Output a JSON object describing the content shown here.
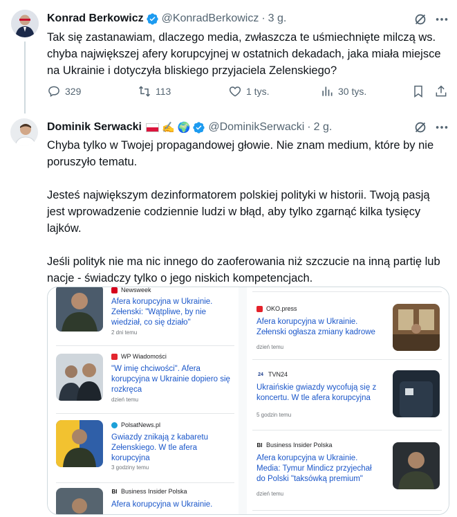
{
  "tweet1": {
    "name": "Konrad Berkowicz",
    "handle": "@KonradBerkowicz",
    "dot": "·",
    "time": "3 g.",
    "text": "Tak się zastanawiam, dlaczego media, zwłaszcza te uśmiechnięte milczą ws. chyba największej afery korupcyjnej w ostatnich dekadach, jaka miała miejsce na Ukrainie i dotyczyła bliskiego przyjaciela Zelenskiego?",
    "replies": "329",
    "reposts": "113",
    "likes": "1 tys.",
    "views": "30 tys."
  },
  "tweet2": {
    "name": "Dominik Serwacki",
    "emojis": [
      "✍️",
      "🌍"
    ],
    "handle": "@DominikSerwacki",
    "dot": "·",
    "time": "2 g.",
    "paragraphs": [
      "Chyba tylko w Twojej propagandowej głowie. Nie znam medium, które by nie poruszyło tematu.",
      "Jesteś największym dezinformatorem polskiej polityki w historii. Twoją pasją jest wprowadzenie codziennie ludzi w błąd, aby tylko zgarnąć kilka tysięcy lajków.",
      "Jeśli polityk nie ma nic innego do zaoferowania niż szczucie na inną partię lub nacje - świadczy tylko o jego niskich kompetencjach."
    ]
  },
  "media": {
    "left": [
      {
        "source": "Newsweek",
        "headline": "Afera korupcyjna w Ukrainie. Zełenski: \"Wątpliwe, by nie wiedział, co się działo\"",
        "ago": "2 dni temu",
        "logo_color": "#d6001c"
      },
      {
        "source": "WP Wiadomości",
        "headline": "\"W imię chciwości\". Afera korupcyjna w Ukrainie dopiero się rozkręca",
        "ago": "dzień temu",
        "logo_color": "#e3262e"
      },
      {
        "source": "PolsatNews.pl",
        "headline": "Gwiazdy znikają z kabaretu Zełenskiego. W tle afera korupcyjna",
        "ago": "3 godziny temu",
        "logo_color": "#1ca0d8"
      },
      {
        "source": "Business Insider Polska",
        "headline": "Afera korupcyjna w Ukrainie.",
        "ago": "",
        "logo_color": "#111111"
      }
    ],
    "right": [
      {
        "source": "OKO.press",
        "headline": "Afera korupcyjna w Ukrainie. Zełenski ogłasza zmiany kadrowe",
        "ago": "dzień temu",
        "logo_color": "#e4222b"
      },
      {
        "source": "TVN24",
        "headline": "Ukraińskie gwiazdy wycofują się z koncertu. W tle afera korupcyjna",
        "ago": "5 godzin temu",
        "logo_color": "#1c3d8c"
      },
      {
        "source": "Business Insider Polska",
        "headline": "Afera korupcyjna w Ukrainie. Media: Tymur Mindicz przyjechał do Polski \"taksówką premium\"",
        "ago": "dzień temu",
        "logo_color": "#111111"
      }
    ]
  },
  "colors": {
    "text": "#0f1419",
    "secondary": "#536471",
    "verified": "#1d9bf0",
    "link": "#1a56c9"
  }
}
